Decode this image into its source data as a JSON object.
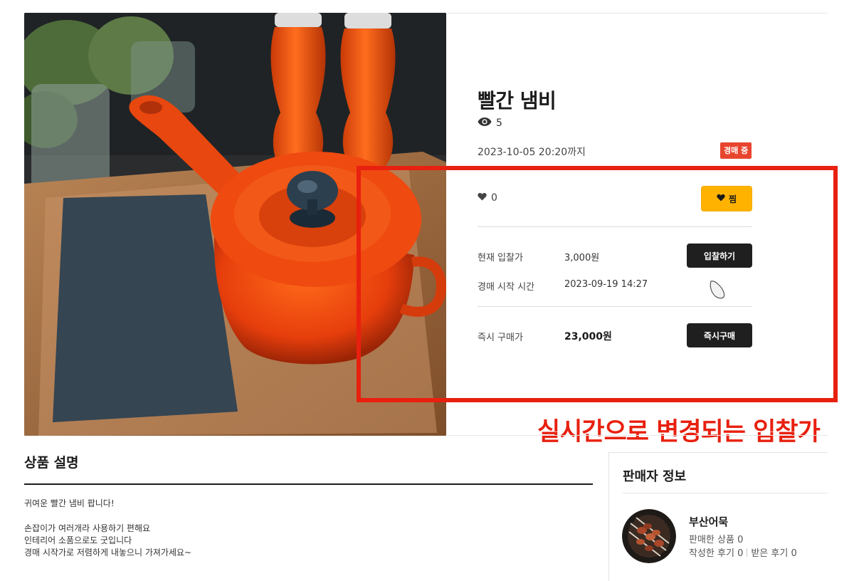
{
  "product": {
    "title": "빨간 냄비",
    "views": "5",
    "deadline": "2023-10-05 20:20까지",
    "status": "경매 중",
    "likes": "0",
    "zzim_label": "찜"
  },
  "bidding": {
    "current_bid_label": "현재 입찰가",
    "current_bid_value": "3,000원",
    "bid_button": "입찰하기",
    "start_time_label": "경매 시작 시간",
    "start_time_value": "2023-09-19 14:27",
    "buy_now_label": "즉시 구매가",
    "buy_now_value": "23,000원",
    "buy_now_button": "즉시구매"
  },
  "annotation": {
    "text": "실시간으로 변경되는 입찰가"
  },
  "description": {
    "heading": "상품 설명",
    "lines": [
      "귀여운 빨간 냄비 팝니다!",
      "손잡이가 여러개라 사용하기 편해요",
      "인테리어 소품으로도 굿입니다",
      "경매 시작가로 저렴하게 내놓으니 가져가세요~"
    ]
  },
  "seller": {
    "heading": "판매자 정보",
    "name": "부산어묵",
    "sold": "판매한 상품 0",
    "written_reviews": "작성한 후기 0",
    "received_reviews": "받은 후기 0"
  },
  "colors": {
    "accent_red": "#e8200f",
    "status_red": "#e8452f",
    "zzim_yellow": "#ffb300",
    "button_dark": "#1f1f1f"
  },
  "icons": [
    "eye-icon",
    "heart-icon",
    "mouse-cursor-icon"
  ]
}
